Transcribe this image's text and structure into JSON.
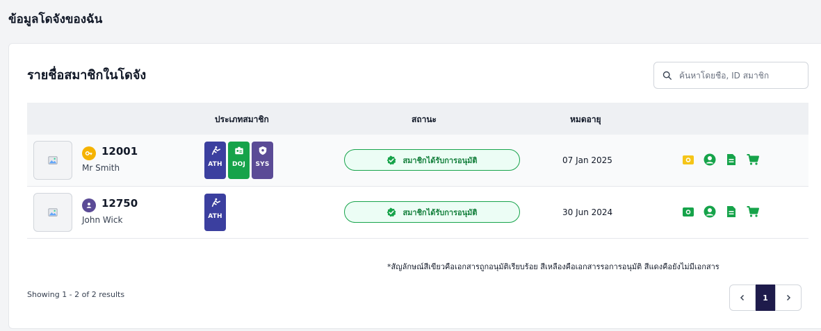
{
  "page_title": "ข้อมูลโดจังของฉัน",
  "card_title": "รายชื่อสมาชิกในโดจัง",
  "search": {
    "placeholder": "ค้นหาโดยชื่อ, ID สมาชิก",
    "icon": "search-icon"
  },
  "table": {
    "columns": [
      "",
      "ประเภทสมาชิก",
      "สถานะ",
      "หมดอายุ",
      ""
    ],
    "rows": [
      {
        "member_id": "12001",
        "name": "Mr Smith",
        "avatar_icon": "key-icon",
        "avatar_color": "#f5b301",
        "types": [
          "ATH",
          "DOJ",
          "SYS"
        ],
        "status": "สมาชิกได้รับการอนุมัติ",
        "expiry": "07 Jan 2025",
        "actions": [
          {
            "icon": "camera-icon",
            "color": "#f5c518"
          },
          {
            "icon": "user-icon",
            "color": "#16a34a"
          },
          {
            "icon": "document-icon",
            "color": "#16a34a"
          },
          {
            "icon": "cart-icon",
            "color": "#16a34a"
          }
        ]
      },
      {
        "member_id": "12750",
        "name": "John Wick",
        "avatar_icon": "user-icon",
        "avatar_color": "#5b4b96",
        "types": [
          "ATH"
        ],
        "status": "สมาชิกได้รับการอนุมัติ",
        "expiry": "30 Jun 2024",
        "actions": [
          {
            "icon": "camera-icon",
            "color": "#16a34a"
          },
          {
            "icon": "user-icon",
            "color": "#16a34a"
          },
          {
            "icon": "document-icon",
            "color": "#16a34a"
          },
          {
            "icon": "cart-icon",
            "color": "#16a34a"
          }
        ]
      }
    ]
  },
  "note": "*สัญลักษณ์สีเขียวคือเอกสารถูกอนุมัติเรียบร้อย สีเหลืองคือเอกสารรอการอนุมัติ สีแดงคือยังไม่มีเอกสาร",
  "results_text": "Showing 1 - 2 of 2 results",
  "pagination": {
    "current": "1"
  },
  "colors": {
    "ath": "#3b3f9f",
    "doj": "#16a34a",
    "sys": "#5b4b96",
    "approved_green": "#16a34a",
    "pending_yellow": "#f5c518",
    "pager_active": "#1e1b4b"
  }
}
